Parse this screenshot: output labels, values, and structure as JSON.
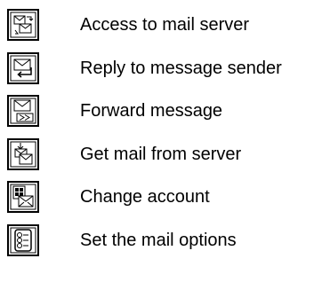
{
  "items": [
    {
      "label": "Access to mail server",
      "icon": "mail-server-access-icon"
    },
    {
      "label": "Reply to message sender",
      "icon": "reply-icon"
    },
    {
      "label": "Forward message",
      "icon": "forward-icon"
    },
    {
      "label": "Get mail from server",
      "icon": "get-mail-icon"
    },
    {
      "label": "Change account",
      "icon": "change-account-icon"
    },
    {
      "label": "Set the mail options",
      "icon": "mail-options-icon"
    }
  ]
}
